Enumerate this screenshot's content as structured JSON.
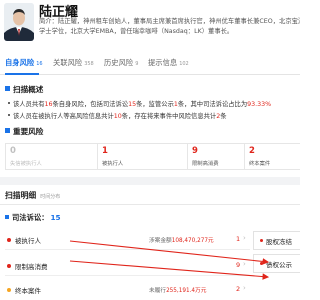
{
  "profile": {
    "name": "陆正耀",
    "intro_lines": [
      "简介：陆正耀，神州租车创始人，董事局主席兼首席执行官，神州优车董事长兼CEO，北京宝沃",
      "学士学位，北京大学EMBA，曾任瑞幸咖啡（Nasdaq：LK）董事长。"
    ]
  },
  "tabs": [
    {
      "label": "自身风险",
      "count": "16",
      "active": true
    },
    {
      "label": "关联风险",
      "count": "358",
      "active": false
    },
    {
      "label": "历史风险",
      "count": "9",
      "active": false
    },
    {
      "label": "提示信息",
      "count": "102",
      "active": false
    }
  ],
  "scan_overview": {
    "heading": "扫描概述",
    "items": [
      {
        "a": "该人员共有",
        "b": "16",
        "c": "条自身风险，包括司法诉讼",
        "d": "15",
        "e": "条，监管公示",
        "f": "1",
        "g": "条，其中司法诉讼占比为",
        "h": "93.33%"
      },
      {
        "a": "该人员在被执行人等高风险信息共计",
        "b": "10",
        "c": "条，存在将来事件中风险信息共计",
        "d": "2",
        "e": "条",
        "f": "",
        "g": "",
        "h": ""
      }
    ]
  },
  "major_risk": {
    "heading": "重要风险",
    "cells": [
      {
        "num": "0",
        "label": "失信被执行人",
        "muted": true
      },
      {
        "num": "1",
        "label": "被执行人",
        "muted": false
      },
      {
        "num": "9",
        "label": "限制高消费",
        "muted": false
      },
      {
        "num": "2",
        "label": "终本案件",
        "muted": false
      }
    ]
  },
  "scan_detail": {
    "heading": "扫描明细",
    "sub": "时间分布"
  },
  "litigation": {
    "heading": "司法诉讼",
    "count": "15",
    "rows": [
      {
        "title": "被执行人",
        "amount_label": "涉案金额",
        "amount": "108,470,277元",
        "count": "1",
        "color": "#e0251b"
      },
      {
        "title": "限制高消费",
        "amount_label": "",
        "amount": "",
        "count": "9",
        "color": "#e0251b"
      },
      {
        "title": "终本案件",
        "amount_label": "未履行",
        "amount": "255,191.4万元",
        "count": "2",
        "color": "#f5a623"
      }
    ]
  },
  "right_panel": [
    {
      "label": "股权冻结"
    },
    {
      "label": "债权公示"
    }
  ],
  "colors": {
    "accent": "#1a73e8",
    "risk_red": "#e0251b",
    "warn": "#f5a623"
  }
}
